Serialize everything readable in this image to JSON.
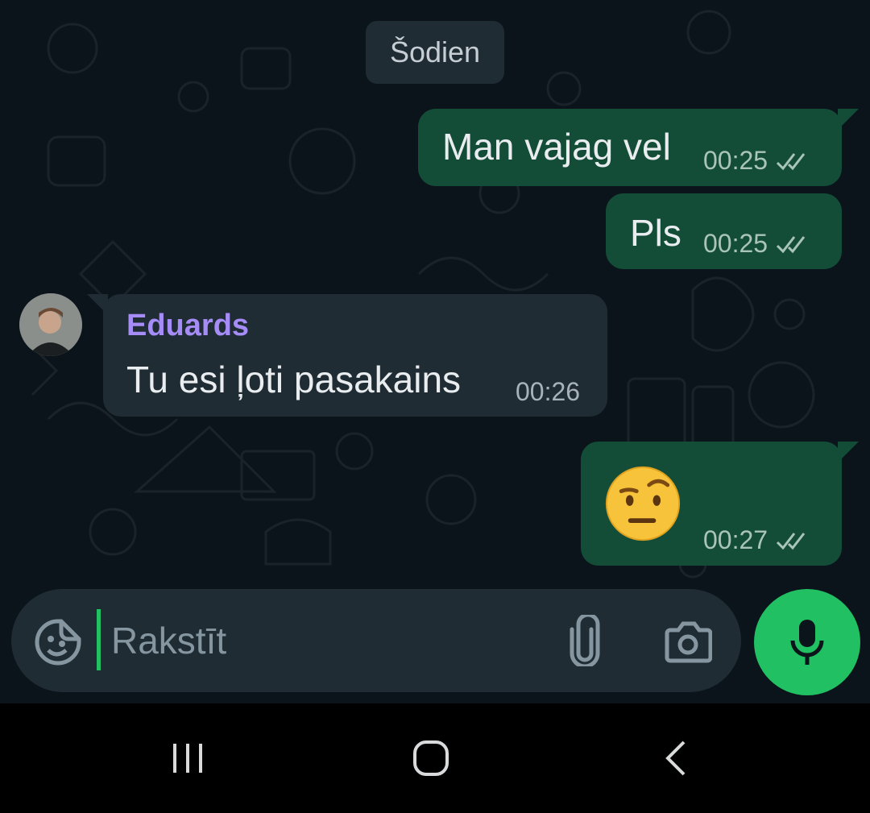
{
  "chat": {
    "date_separator": "Šodien",
    "messages": [
      {
        "direction": "outgoing",
        "text": "Man vajag vel",
        "time": "00:25",
        "status": "read"
      },
      {
        "direction": "outgoing",
        "text": "Pls",
        "time": "00:25",
        "status": "read"
      },
      {
        "direction": "incoming",
        "sender": "Eduards",
        "text": "Tu esi ļoti pasakains",
        "time": "00:26"
      },
      {
        "direction": "outgoing",
        "text": "🤨",
        "time": "00:27",
        "status": "read"
      }
    ]
  },
  "composer": {
    "placeholder": "Rakstīt",
    "value": "",
    "icons": [
      "sticker-icon",
      "attach-icon",
      "camera-icon",
      "mic-icon"
    ]
  },
  "navbar": {
    "icons": [
      "recent-apps-icon",
      "home-icon",
      "back-icon"
    ]
  },
  "colors": {
    "background": "#0b141a",
    "outgoing_bubble": "#144d37",
    "incoming_bubble": "#1f2c34",
    "sender_name": "#a68cf7",
    "accent": "#21c063"
  }
}
